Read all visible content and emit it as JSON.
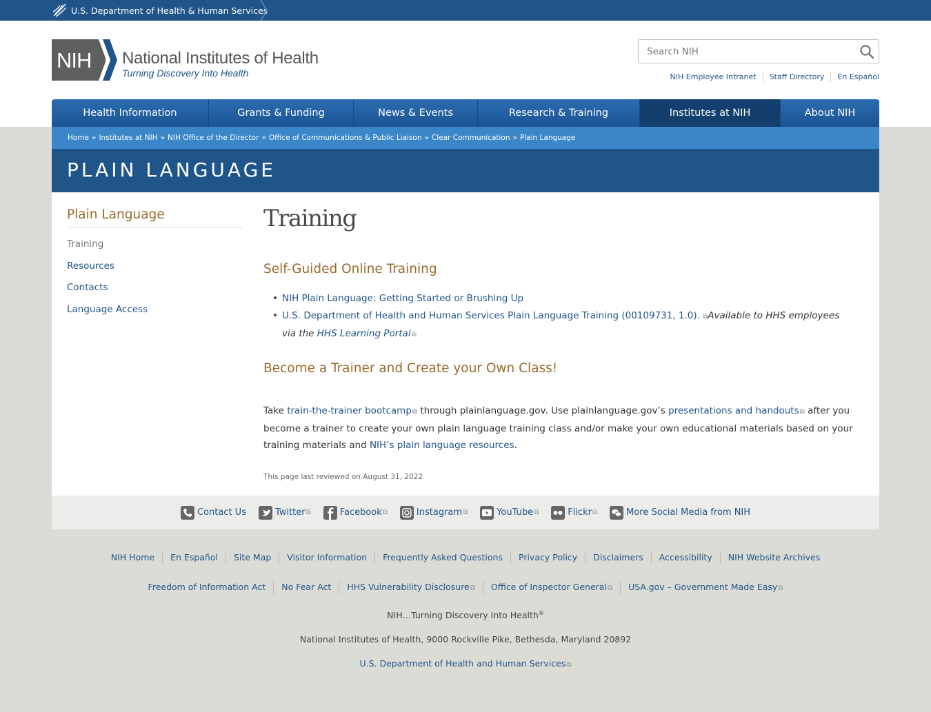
{
  "hhs_bar": {
    "label": "U.S. Department of Health & Human Services"
  },
  "header": {
    "logo_abbr": "NIH",
    "logo_title": "National Institutes of Health",
    "logo_tagline": "Turning Discovery Into Health",
    "search_placeholder": "Search NIH",
    "util_links": [
      "NIH Employee Intranet",
      "Staff Directory",
      "En Español"
    ]
  },
  "nav": {
    "items": [
      "Health Information",
      "Grants & Funding",
      "News & Events",
      "Research & Training",
      "Institutes at NIH",
      "About NIH"
    ],
    "active": "Institutes at NIH"
  },
  "breadcrumb": [
    "Home",
    "Institutes at NIH",
    "NIH Office of the Director",
    "Office of Communications & Public Liaison",
    "Clear Communication",
    "Plain Language"
  ],
  "page_title": "PLAIN LANGUAGE",
  "sidebar": {
    "title": "Plain Language",
    "items": [
      "Training",
      "Resources",
      "Contacts",
      "Language Access"
    ]
  },
  "main": {
    "heading": "Training",
    "section1_title": "Self-Guided Online Training",
    "link1": "NIH Plain Language: Getting Started or Brushing Up",
    "link2": "U.S. Department of Health and Human Services Plain Language Training (00109731, 1.0).",
    "link2_note_a": "Available to HHS employees via the ",
    "link2_note_link": "HHS Learning Portal",
    "section2_title": "Become a Trainer and Create your Own Class!",
    "para_1": "Take ",
    "para_link1": "train-the-trainer bootcamp",
    "para_2": " through plainlanguage.gov. Use plainlanguage.gov’s ",
    "para_link2": "presentations and handouts",
    "para_3": " after you become a trainer to create your own plain language training class and/or make your own educational materials based on your training materials and ",
    "para_link3": "NIH’s plain language resources",
    "para_4": ".",
    "reviewed": "This page last reviewed on August 31, 2022"
  },
  "social": [
    "Contact Us",
    "Twitter",
    "Facebook",
    "Instagram",
    "YouTube",
    "Flickr",
    "More Social Media from NIH"
  ],
  "footer": {
    "row1": [
      "NIH Home",
      "En Español",
      "Site Map",
      "Visitor Information",
      "Frequently Asked Questions",
      "Privacy Policy",
      "Disclaimers",
      "Accessibility",
      "NIH Website Archives"
    ],
    "row2": [
      "Freedom of Information Act",
      "No Fear Act",
      "HHS Vulnerability Disclosure",
      "Office of Inspector General",
      "USA.gov – Government Made Easy"
    ],
    "tagline": "NIH…Turning Discovery Into Health",
    "tagline_mark": "®",
    "address": "National Institutes of Health, 9000 Rockville Pike, Bethesda, Maryland 20892",
    "hhs_link": "U.S. Department of Health and Human Services"
  },
  "colors": {
    "primary_blue": "#20558a",
    "accent_gold": "#9a6a2c",
    "breadcrumb_blue": "#3b86c8"
  }
}
